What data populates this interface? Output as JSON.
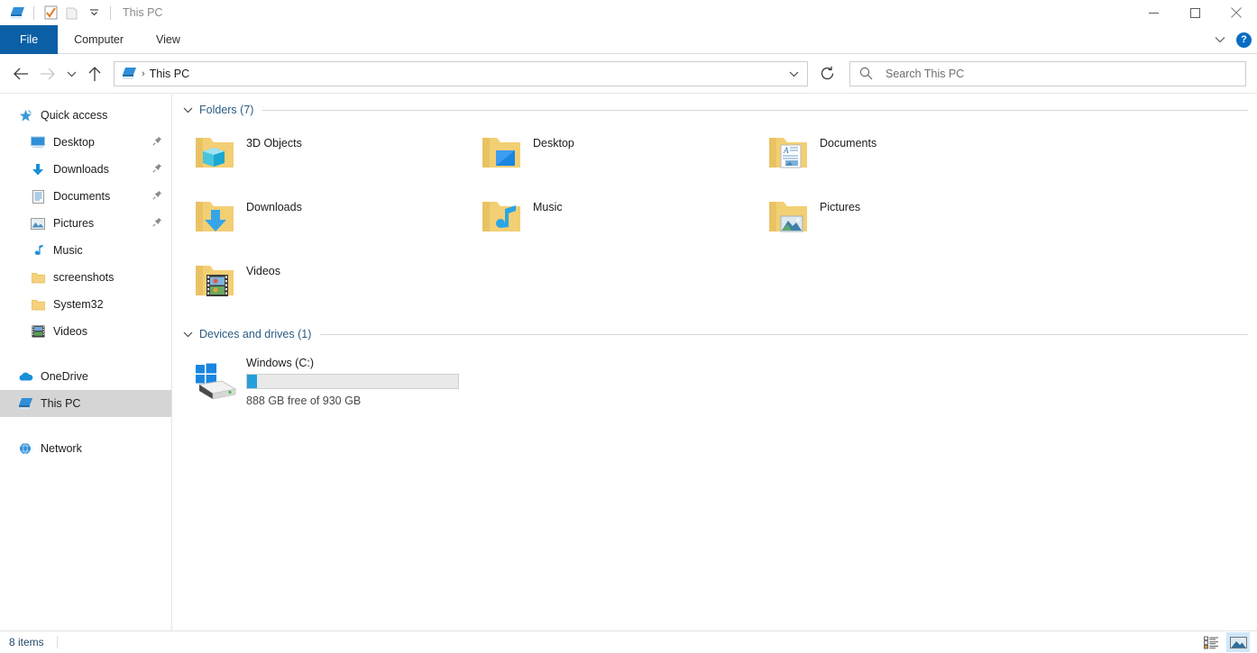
{
  "window": {
    "title": "This PC",
    "quick_access_toolbar": [
      {
        "name": "this-pc-icon",
        "tooltip": "This PC"
      },
      {
        "name": "properties-icon",
        "tooltip": "Properties"
      },
      {
        "name": "new-folder-icon",
        "tooltip": "New folder"
      },
      {
        "name": "customize-chevron-icon",
        "tooltip": "Customize Quick Access Toolbar"
      }
    ],
    "controls": {
      "minimize": "minimize-button",
      "maximize": "maximize-button",
      "close": "close-button"
    }
  },
  "ribbon": {
    "tabs": [
      {
        "label": "File",
        "active": true
      },
      {
        "label": "Computer",
        "active": false
      },
      {
        "label": "View",
        "active": false
      }
    ],
    "expand_icon": "chevron-down-icon",
    "help_label": "?"
  },
  "nav": {
    "back_icon": "back-arrow-icon",
    "forward_icon": "forward-arrow-icon",
    "recent_icon": "recent-locations-icon",
    "up_icon": "up-arrow-icon",
    "breadcrumb": {
      "icon": "this-pc-icon",
      "separator": "›",
      "text": "This PC"
    },
    "address_dropdown_icon": "chevron-down-icon",
    "refresh_icon": "refresh-icon"
  },
  "search": {
    "icon": "search-icon",
    "placeholder": "Search This PC",
    "value": ""
  },
  "sidebar": {
    "items": [
      {
        "label": "Quick access",
        "icon": "quick-access-star-icon",
        "level": 0,
        "pinned": false,
        "selected": false
      },
      {
        "label": "Desktop",
        "icon": "desktop-icon",
        "level": 1,
        "pinned": true,
        "selected": false
      },
      {
        "label": "Downloads",
        "icon": "downloads-arrow-icon",
        "level": 1,
        "pinned": true,
        "selected": false
      },
      {
        "label": "Documents",
        "icon": "documents-icon",
        "level": 1,
        "pinned": true,
        "selected": false
      },
      {
        "label": "Pictures",
        "icon": "pictures-icon",
        "level": 1,
        "pinned": true,
        "selected": false
      },
      {
        "label": "Music",
        "icon": "music-note-icon",
        "level": 1,
        "pinned": false,
        "selected": false
      },
      {
        "label": "screenshots",
        "icon": "folder-icon",
        "level": 1,
        "pinned": false,
        "selected": false
      },
      {
        "label": "System32",
        "icon": "folder-icon",
        "level": 1,
        "pinned": false,
        "selected": false
      },
      {
        "label": "Videos",
        "icon": "videos-icon",
        "level": 1,
        "pinned": false,
        "selected": false
      },
      {
        "label": "OneDrive",
        "icon": "onedrive-cloud-icon",
        "level": 0,
        "pinned": false,
        "selected": false,
        "gap_before": true
      },
      {
        "label": "This PC",
        "icon": "this-pc-icon",
        "level": 0,
        "pinned": false,
        "selected": true
      },
      {
        "label": "Network",
        "icon": "network-icon",
        "level": 0,
        "pinned": false,
        "selected": false,
        "gap_before": true
      }
    ]
  },
  "content": {
    "sections": [
      {
        "title": "Folders (7)",
        "chevron": "chevron-down-icon",
        "items": [
          {
            "label": "3D Objects",
            "icon": "folder-3d-objects-icon"
          },
          {
            "label": "Desktop",
            "icon": "folder-desktop-icon"
          },
          {
            "label": "Documents",
            "icon": "folder-documents-icon"
          },
          {
            "label": "Downloads",
            "icon": "folder-downloads-icon"
          },
          {
            "label": "Music",
            "icon": "folder-music-icon"
          },
          {
            "label": "Pictures",
            "icon": "folder-pictures-icon"
          },
          {
            "label": "Videos",
            "icon": "folder-videos-icon"
          }
        ]
      },
      {
        "title": "Devices and drives (1)",
        "chevron": "chevron-down-icon",
        "drives": [
          {
            "label": "Windows (C:)",
            "icon": "windows-drive-icon",
            "free_text": "888 GB free of 930 GB",
            "used_percent": 4.5,
            "bar_color": "#26a0da"
          }
        ]
      }
    ]
  },
  "statusbar": {
    "item_count": "8 items",
    "view_buttons": [
      {
        "name": "details-view-button",
        "active": false
      },
      {
        "name": "large-icons-view-button",
        "active": true
      }
    ]
  },
  "colors": {
    "accent": "#0b5fa5",
    "section_header": "#2b5b84",
    "selection": "#d5d5d5",
    "drive_bar": "#26a0da",
    "help_blue": "#0a6cc4"
  }
}
